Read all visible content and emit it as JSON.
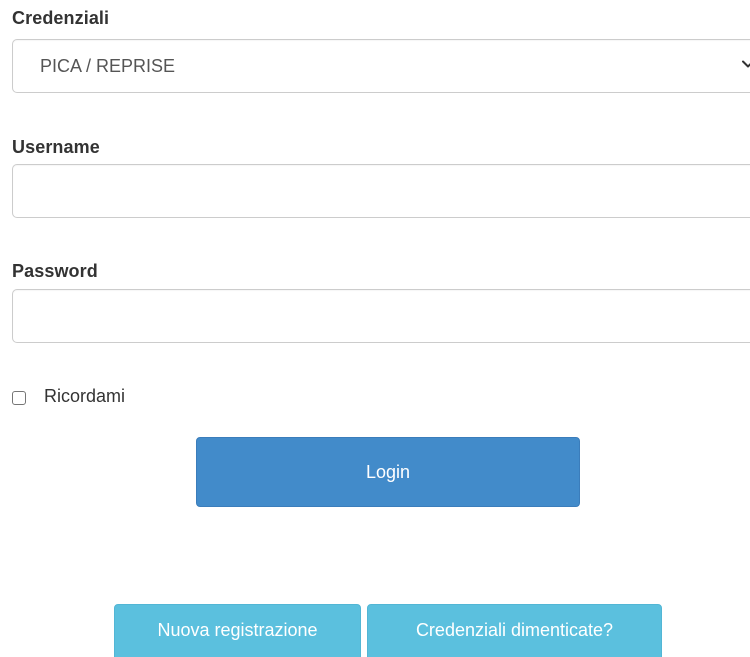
{
  "form": {
    "credentials_label": "Credenziali",
    "credentials_selected": "PICA / REPRISE",
    "username_label": "Username",
    "username_value": "",
    "password_label": "Password",
    "password_value": "",
    "remember_label": "Ricordami",
    "remember_checked": false,
    "login_label": "Login"
  },
  "footer": {
    "register_label": "Nuova registrazione",
    "forgot_label": "Credenziali dimenticate?"
  },
  "icons": {
    "select_arrow": "chevron-down-icon"
  },
  "colors": {
    "primary": "#428bca",
    "info": "#5bc0de",
    "text": "#333333",
    "border": "#cccccc"
  }
}
